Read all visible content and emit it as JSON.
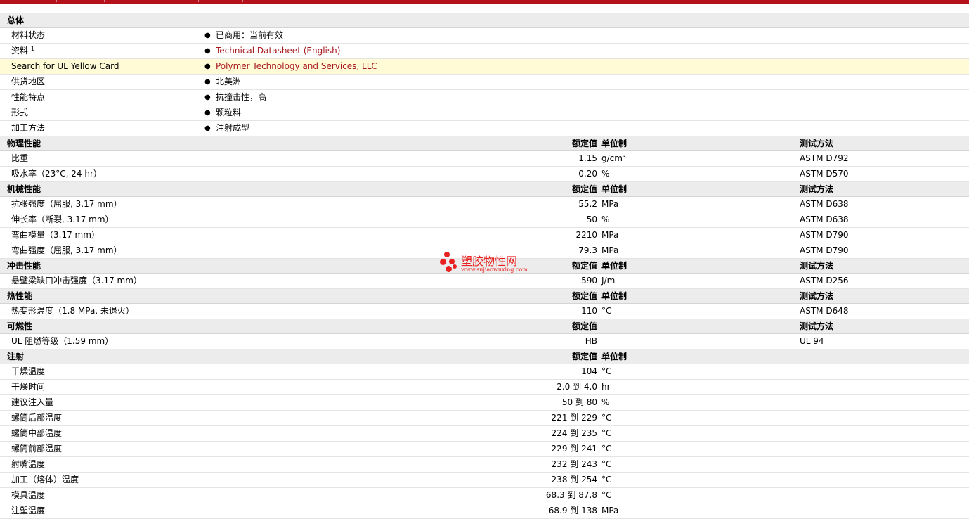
{
  "sections": [
    {
      "kind": "general",
      "title": "总体",
      "rows": [
        {
          "label": "材料状态",
          "value": "已商用：当前有效"
        },
        {
          "label": "资料",
          "sup": "1",
          "value": "Technical Datasheet (English)",
          "link": true
        },
        {
          "label": "Search for UL Yellow Card",
          "value": "Polymer Technology and Services, LLC",
          "link": true,
          "highlight": true
        },
        {
          "label": "供货地区",
          "value": "北美洲"
        },
        {
          "label": "性能特点",
          "value": "抗撞击性，高"
        },
        {
          "label": "形式",
          "value": "颗粒料"
        },
        {
          "label": "加工方法",
          "value": "注射成型"
        }
      ]
    },
    {
      "kind": "props",
      "title": "物理性能",
      "h_value": "额定值",
      "h_unit": "单位制",
      "h_test": "测试方法",
      "rows": [
        {
          "label": "比重",
          "value": "1.15",
          "unit": "g/cm³",
          "test": "ASTM D792"
        },
        {
          "label": "吸水率（23°C, 24 hr）",
          "value": "0.20",
          "unit": "%",
          "test": "ASTM D570"
        }
      ]
    },
    {
      "kind": "props",
      "title": "机械性能",
      "h_value": "额定值",
      "h_unit": "单位制",
      "h_test": "测试方法",
      "rows": [
        {
          "label": "抗张强度（屈服, 3.17 mm）",
          "value": "55.2",
          "unit": "MPa",
          "test": "ASTM D638"
        },
        {
          "label": "伸长率（断裂, 3.17 mm）",
          "value": "50",
          "unit": "%",
          "test": "ASTM D638"
        },
        {
          "label": "弯曲模量（3.17 mm）",
          "value": "2210",
          "unit": "MPa",
          "test": "ASTM D790"
        },
        {
          "label": "弯曲强度（屈服, 3.17 mm）",
          "value": "79.3",
          "unit": "MPa",
          "test": "ASTM D790"
        }
      ]
    },
    {
      "kind": "props",
      "title": "冲击性能",
      "h_value": "额定值",
      "h_unit": "单位制",
      "h_test": "测试方法",
      "rows": [
        {
          "label": "悬壁梁缺口冲击强度（3.17 mm）",
          "value": "590",
          "unit": "J/m",
          "test": "ASTM D256"
        }
      ]
    },
    {
      "kind": "props",
      "title": "热性能",
      "h_value": "额定值",
      "h_unit": "单位制",
      "h_test": "测试方法",
      "rows": [
        {
          "label": "热变形温度（1.8 MPa, 未退火）",
          "value": "110",
          "unit": "°C",
          "test": "ASTM D648"
        }
      ]
    },
    {
      "kind": "props",
      "title": "可燃性",
      "h_value": "额定值",
      "h_unit": "",
      "h_test": "测试方法",
      "rows": [
        {
          "label": "UL 阻燃等级（1.59 mm）",
          "value": "HB",
          "unit": "",
          "test": "UL 94"
        }
      ]
    },
    {
      "kind": "props",
      "title": "注射",
      "h_value": "额定值",
      "h_unit": "单位制",
      "h_test": "",
      "rows": [
        {
          "label": "干燥温度",
          "value": "104",
          "unit": "°C",
          "test": ""
        },
        {
          "label": "干燥时间",
          "value": "2.0 到  4.0",
          "unit": "hr",
          "test": ""
        },
        {
          "label": "建议注入量",
          "value": "50 到  80",
          "unit": "%",
          "test": ""
        },
        {
          "label": "螺筒后部温度",
          "value": "221 到  229",
          "unit": "°C",
          "test": ""
        },
        {
          "label": "螺筒中部温度",
          "value": "224 到  235",
          "unit": "°C",
          "test": ""
        },
        {
          "label": "螺筒前部温度",
          "value": "229 到  241",
          "unit": "°C",
          "test": ""
        },
        {
          "label": "射嘴温度",
          "value": "232 到  243",
          "unit": "°C",
          "test": ""
        },
        {
          "label": "加工（熔体）温度",
          "value": "238 到  254",
          "unit": "°C",
          "test": ""
        },
        {
          "label": "模具温度",
          "value": "68.3 到  87.8",
          "unit": "°C",
          "test": ""
        },
        {
          "label": "注塑温度",
          "value": "68.9 到  138",
          "unit": "MPa",
          "test": ""
        }
      ]
    }
  ],
  "watermark": {
    "title": "塑胶物性网",
    "url": "www.sujiaowuxing.com",
    "color": "#e8201f"
  },
  "colors": {
    "brand_bar": "#b5121b",
    "link": "#a8191f",
    "section_bg": "#ececec",
    "highlight_bg": "#fffbd6"
  }
}
